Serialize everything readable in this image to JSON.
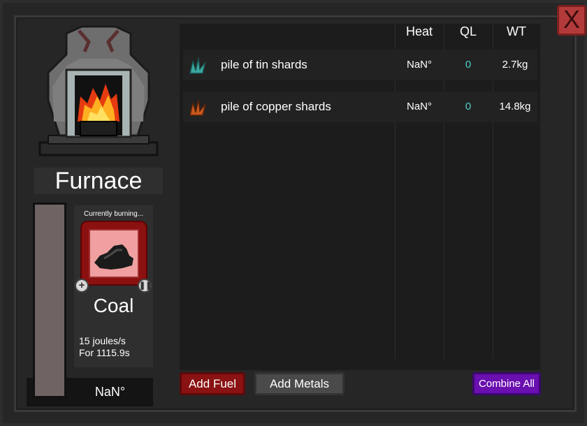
{
  "window": {
    "close_label": "X"
  },
  "furnace": {
    "title": "Furnace",
    "temperature": "NaN°"
  },
  "fuel": {
    "status_label": "Currently burning...",
    "name": "Coal",
    "rate": "15 joules/s",
    "duration": "For 1115.9s",
    "add_icon": "plus-icon",
    "pause_icon": "pause-icon"
  },
  "table": {
    "headers": {
      "heat": "Heat",
      "ql": "QL",
      "wt": "WT"
    },
    "rows": [
      {
        "name": "pile of tin shards",
        "heat": "NaN°",
        "ql": "0",
        "wt": "2.7kg",
        "icon": "tin-shards-icon",
        "icon_color": "#3aa8a0"
      },
      {
        "name": "pile of copper shards",
        "heat": "NaN°",
        "ql": "0",
        "wt": "14.8kg",
        "icon": "copper-shards-icon",
        "icon_color": "#c8581e"
      }
    ]
  },
  "buttons": {
    "add_fuel": "Add Fuel",
    "add_metals": "Add Metals",
    "combine_all": "Combine All"
  },
  "colors": {
    "add_fuel": "#8a1212",
    "add_metals": "#4a4a4a",
    "combine_all": "#6a0fb0",
    "ql_value": "#4fd0cf",
    "close": "#b33a3a"
  }
}
